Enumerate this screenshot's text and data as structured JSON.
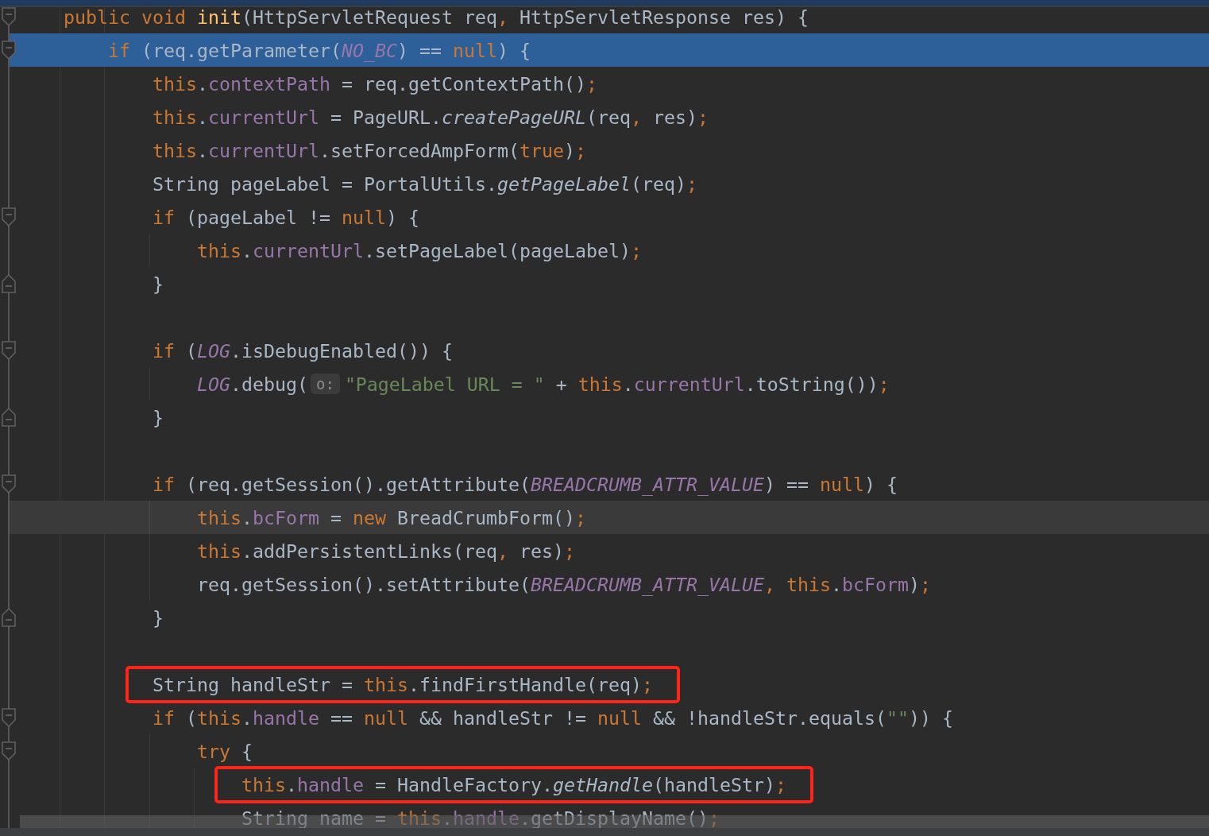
{
  "lines": [
    {
      "selected": false,
      "current": false,
      "kind": "block-start",
      "boxed": false,
      "tokens": [
        {
          "kind": "kw",
          "text": "public "
        },
        {
          "kind": "kw",
          "text": "void "
        },
        {
          "kind": "decl",
          "text": "init"
        },
        {
          "kind": "plain",
          "text": "(HttpServletRequest req"
        },
        {
          "kind": "kw",
          "text": ","
        },
        {
          "kind": "plain",
          "text": " HttpServletResponse res) {"
        }
      ],
      "children": [
        {
          "selected": true,
          "current": false,
          "kind": "block-start",
          "boxed": false,
          "tokens": [
            {
              "kind": "kw",
              "text": "if"
            },
            {
              "kind": "plain",
              "text": " (req.getParameter("
            },
            {
              "kind": "const",
              "text": "NO_BC"
            },
            {
              "kind": "plain",
              "text": ") == "
            },
            {
              "kind": "kw",
              "text": "null"
            },
            {
              "kind": "plain",
              "text": ") {"
            }
          ],
          "children": [
            {
              "selected": false,
              "current": false,
              "kind": "line",
              "boxed": false,
              "tokens": [
                {
                  "kind": "kw",
                  "text": "this"
                },
                {
                  "kind": "plain",
                  "text": "."
                },
                {
                  "kind": "field",
                  "text": "contextPath"
                },
                {
                  "kind": "plain",
                  "text": " = req.getContextPath()"
                },
                {
                  "kind": "kw",
                  "text": ";"
                }
              ]
            },
            {
              "selected": false,
              "current": false,
              "kind": "line",
              "boxed": false,
              "tokens": [
                {
                  "kind": "kw",
                  "text": "this"
                },
                {
                  "kind": "plain",
                  "text": "."
                },
                {
                  "kind": "field",
                  "text": "currentUrl"
                },
                {
                  "kind": "plain",
                  "text": " = PageURL."
                },
                {
                  "kind": "smethod",
                  "text": "createPageURL"
                },
                {
                  "kind": "plain",
                  "text": "(req"
                },
                {
                  "kind": "kw",
                  "text": ","
                },
                {
                  "kind": "plain",
                  "text": " res)"
                },
                {
                  "kind": "kw",
                  "text": ";"
                }
              ]
            },
            {
              "selected": false,
              "current": false,
              "kind": "line",
              "boxed": false,
              "tokens": [
                {
                  "kind": "kw",
                  "text": "this"
                },
                {
                  "kind": "plain",
                  "text": "."
                },
                {
                  "kind": "field",
                  "text": "currentUrl"
                },
                {
                  "kind": "plain",
                  "text": ".setForcedAmpForm("
                },
                {
                  "kind": "kw",
                  "text": "true"
                },
                {
                  "kind": "plain",
                  "text": ")"
                },
                {
                  "kind": "kw",
                  "text": ";"
                }
              ]
            },
            {
              "selected": false,
              "current": false,
              "kind": "line",
              "boxed": false,
              "tokens": [
                {
                  "kind": "plain",
                  "text": "String pageLabel = PortalUtils."
                },
                {
                  "kind": "smethod",
                  "text": "getPageLabel"
                },
                {
                  "kind": "plain",
                  "text": "(req)"
                },
                {
                  "kind": "kw",
                  "text": ";"
                }
              ]
            },
            {
              "selected": false,
              "current": false,
              "kind": "block-start",
              "boxed": false,
              "tokens": [
                {
                  "kind": "kw",
                  "text": "if"
                },
                {
                  "kind": "plain",
                  "text": " (pageLabel != "
                },
                {
                  "kind": "kw",
                  "text": "null"
                },
                {
                  "kind": "plain",
                  "text": ") {"
                }
              ],
              "children": [
                {
                  "selected": false,
                  "current": false,
                  "kind": "line",
                  "boxed": false,
                  "tokens": [
                    {
                      "kind": "kw",
                      "text": "this"
                    },
                    {
                      "kind": "plain",
                      "text": "."
                    },
                    {
                      "kind": "field",
                      "text": "currentUrl"
                    },
                    {
                      "kind": "plain",
                      "text": ".setPageLabel(pageLabel)"
                    },
                    {
                      "kind": "kw",
                      "text": ";"
                    }
                  ]
                }
              ]
            },
            {
              "selected": false,
              "current": false,
              "kind": "block-end",
              "boxed": false,
              "tokens": [
                {
                  "kind": "plain",
                  "text": "}"
                }
              ]
            },
            {
              "selected": false,
              "current": false,
              "kind": "line",
              "boxed": false
            },
            {
              "selected": false,
              "current": false,
              "kind": "block-start",
              "boxed": false,
              "tokens": [
                {
                  "kind": "kw",
                  "text": "if"
                },
                {
                  "kind": "plain",
                  "text": " ("
                },
                {
                  "kind": "const",
                  "text": "LOG"
                },
                {
                  "kind": "plain",
                  "text": ".isDebugEnabled()) {"
                }
              ],
              "children": [
                {
                  "selected": false,
                  "current": false,
                  "kind": "line",
                  "boxed": false,
                  "tokens": [
                    {
                      "kind": "const",
                      "text": "LOG"
                    },
                    {
                      "kind": "plain",
                      "text": ".debug("
                    },
                    {
                      "kind": "hint",
                      "text": "o:"
                    },
                    {
                      "kind": "str",
                      "text": "\"PageLabel URL = \""
                    },
                    {
                      "kind": "plain",
                      "text": " + "
                    },
                    {
                      "kind": "kw",
                      "text": "this"
                    },
                    {
                      "kind": "plain",
                      "text": "."
                    },
                    {
                      "kind": "field",
                      "text": "currentUrl"
                    },
                    {
                      "kind": "plain",
                      "text": ".toString())"
                    },
                    {
                      "kind": "kw",
                      "text": ";"
                    }
                  ]
                }
              ]
            },
            {
              "selected": false,
              "current": false,
              "kind": "block-end",
              "boxed": false,
              "tokens": [
                {
                  "kind": "plain",
                  "text": "}"
                }
              ]
            },
            {
              "selected": false,
              "current": false,
              "kind": "line",
              "boxed": false
            },
            {
              "selected": false,
              "current": false,
              "kind": "block-start",
              "boxed": false,
              "tokens": [
                {
                  "kind": "kw",
                  "text": "if"
                },
                {
                  "kind": "plain",
                  "text": " (req.getSession().getAttribute("
                },
                {
                  "kind": "const",
                  "text": "BREADCRUMB_ATTR_VALUE"
                },
                {
                  "kind": "plain",
                  "text": ") == "
                },
                {
                  "kind": "kw",
                  "text": "null"
                },
                {
                  "kind": "plain",
                  "text": ") {"
                }
              ],
              "children": [
                {
                  "selected": false,
                  "current": true,
                  "kind": "line",
                  "boxed": false,
                  "tokens": [
                    {
                      "kind": "kw",
                      "text": "this"
                    },
                    {
                      "kind": "plain",
                      "text": "."
                    },
                    {
                      "kind": "field",
                      "text": "bcForm"
                    },
                    {
                      "kind": "plain",
                      "text": " = "
                    },
                    {
                      "kind": "kw",
                      "text": "new"
                    },
                    {
                      "kind": "plain",
                      "text": " BreadCrumbForm()"
                    },
                    {
                      "kind": "kw",
                      "text": ";"
                    }
                  ]
                },
                {
                  "selected": false,
                  "current": false,
                  "kind": "line",
                  "boxed": false,
                  "tokens": [
                    {
                      "kind": "kw",
                      "text": "this"
                    },
                    {
                      "kind": "plain",
                      "text": ".addPersistentLinks(req"
                    },
                    {
                      "kind": "kw",
                      "text": ","
                    },
                    {
                      "kind": "plain",
                      "text": " res)"
                    },
                    {
                      "kind": "kw",
                      "text": ";"
                    }
                  ]
                },
                {
                  "selected": false,
                  "current": false,
                  "kind": "line",
                  "boxed": false,
                  "tokens": [
                    {
                      "kind": "plain",
                      "text": "req.getSession().setAttribute("
                    },
                    {
                      "kind": "const",
                      "text": "BREADCRUMB_ATTR_VALUE"
                    },
                    {
                      "kind": "kw",
                      "text": ", this"
                    },
                    {
                      "kind": "plain",
                      "text": "."
                    },
                    {
                      "kind": "field",
                      "text": "bcForm"
                    },
                    {
                      "kind": "plain",
                      "text": ")"
                    },
                    {
                      "kind": "kw",
                      "text": ";"
                    }
                  ]
                }
              ]
            },
            {
              "selected": false,
              "current": false,
              "kind": "block-end",
              "boxed": false,
              "tokens": [
                {
                  "kind": "plain",
                  "text": "}"
                }
              ]
            },
            {
              "selected": false,
              "current": false,
              "kind": "line",
              "boxed": false
            },
            {
              "selected": false,
              "current": false,
              "kind": "line",
              "boxed": true,
              "tokens": [
                {
                  "kind": "plain",
                  "text": "String handleStr = "
                },
                {
                  "kind": "kw",
                  "text": "this"
                },
                {
                  "kind": "plain",
                  "text": ".findFirstHandle(req)"
                },
                {
                  "kind": "kw",
                  "text": ";"
                }
              ]
            },
            {
              "selected": false,
              "current": false,
              "kind": "block-start",
              "boxed": false,
              "tokens": [
                {
                  "kind": "kw",
                  "text": "if"
                },
                {
                  "kind": "plain",
                  "text": " ("
                },
                {
                  "kind": "kw",
                  "text": "this"
                },
                {
                  "kind": "plain",
                  "text": "."
                },
                {
                  "kind": "field",
                  "text": "handle"
                },
                {
                  "kind": "plain",
                  "text": " == "
                },
                {
                  "kind": "kw",
                  "text": "null"
                },
                {
                  "kind": "plain",
                  "text": " && handleStr != "
                },
                {
                  "kind": "kw",
                  "text": "null"
                },
                {
                  "kind": "plain",
                  "text": " && !handleStr.equals("
                },
                {
                  "kind": "str",
                  "text": "\"\""
                },
                {
                  "kind": "plain",
                  "text": ")) {"
                }
              ],
              "children": [
                {
                  "selected": false,
                  "current": false,
                  "kind": "block-start",
                  "boxed": false,
                  "tokens": [
                    {
                      "kind": "kw",
                      "text": "try"
                    },
                    {
                      "kind": "plain",
                      "text": " {"
                    }
                  ],
                  "children": [
                    {
                      "selected": false,
                      "current": false,
                      "kind": "line",
                      "boxed": true,
                      "tokens": [
                        {
                          "kind": "kw",
                          "text": "this"
                        },
                        {
                          "kind": "plain",
                          "text": "."
                        },
                        {
                          "kind": "field",
                          "text": "handle"
                        },
                        {
                          "kind": "plain",
                          "text": " = HandleFactory."
                        },
                        {
                          "kind": "smethod",
                          "text": "getHandle"
                        },
                        {
                          "kind": "plain",
                          "text": "(handleStr)"
                        },
                        {
                          "kind": "kw",
                          "text": ";"
                        }
                      ]
                    },
                    {
                      "selected": false,
                      "current": false,
                      "kind": "line",
                      "boxed": false,
                      "tokens": [
                        {
                          "kind": "plain",
                          "text": "String name = "
                        },
                        {
                          "kind": "kw",
                          "text": "this"
                        },
                        {
                          "kind": "plain",
                          "text": "."
                        },
                        {
                          "kind": "field",
                          "text": "handle"
                        },
                        {
                          "kind": "plain",
                          "text": ".getDisplayName()"
                        },
                        {
                          "kind": "kw",
                          "text": ";"
                        }
                      ]
                    }
                  ]
                }
              ]
            }
          ]
        }
      ]
    }
  ]
}
